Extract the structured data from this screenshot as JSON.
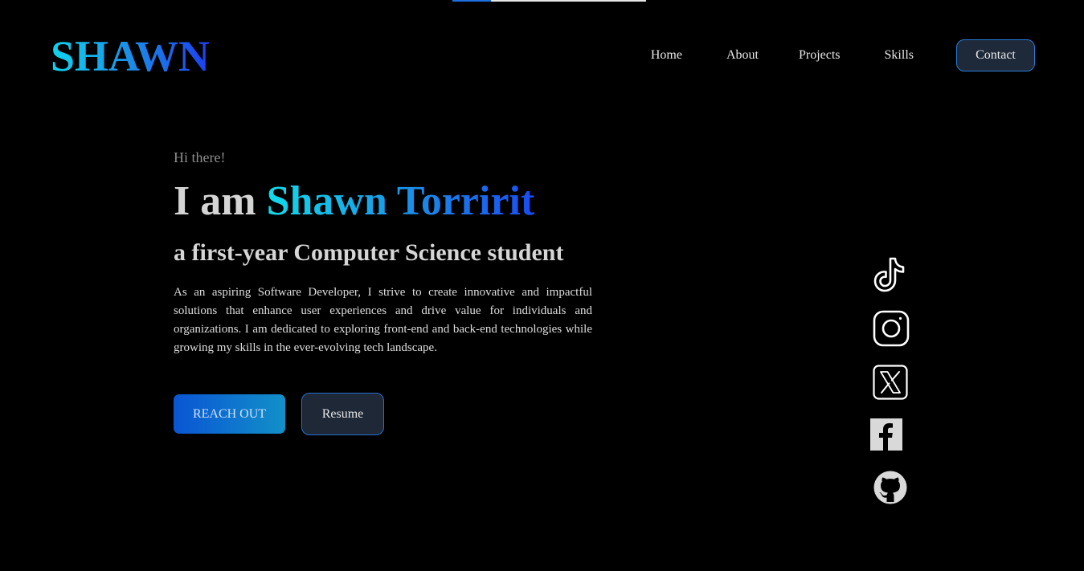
{
  "progress": {
    "value": 0.2
  },
  "header": {
    "logo": "SHAWN",
    "nav": {
      "home": "Home",
      "about": "About",
      "projects": "Projects",
      "skills": "Skills",
      "contact": "Contact"
    }
  },
  "hero": {
    "greeting": "Hi there!",
    "headline_prefix": "I am ",
    "headline_name": "Shawn Torririt",
    "subheadline": "a first-year Computer Science student",
    "bio": "As an aspiring Software Developer, I strive to create innovative and impactful solutions that enhance user experiences and drive value for individuals and organizations. I am dedicated to exploring front-end and back-end technologies while growing my skills in the ever-evolving tech landscape.",
    "reach_out_label": "REACH OUT",
    "resume_label": "Resume"
  },
  "social": [
    "tiktok-icon",
    "instagram-icon",
    "x-icon",
    "facebook-icon",
    "github-icon"
  ],
  "colors": {
    "background": "#000000",
    "accent_start": "#0fd5ef",
    "accent_end": "#1c3ff0",
    "button_border": "#2a7bd8"
  }
}
